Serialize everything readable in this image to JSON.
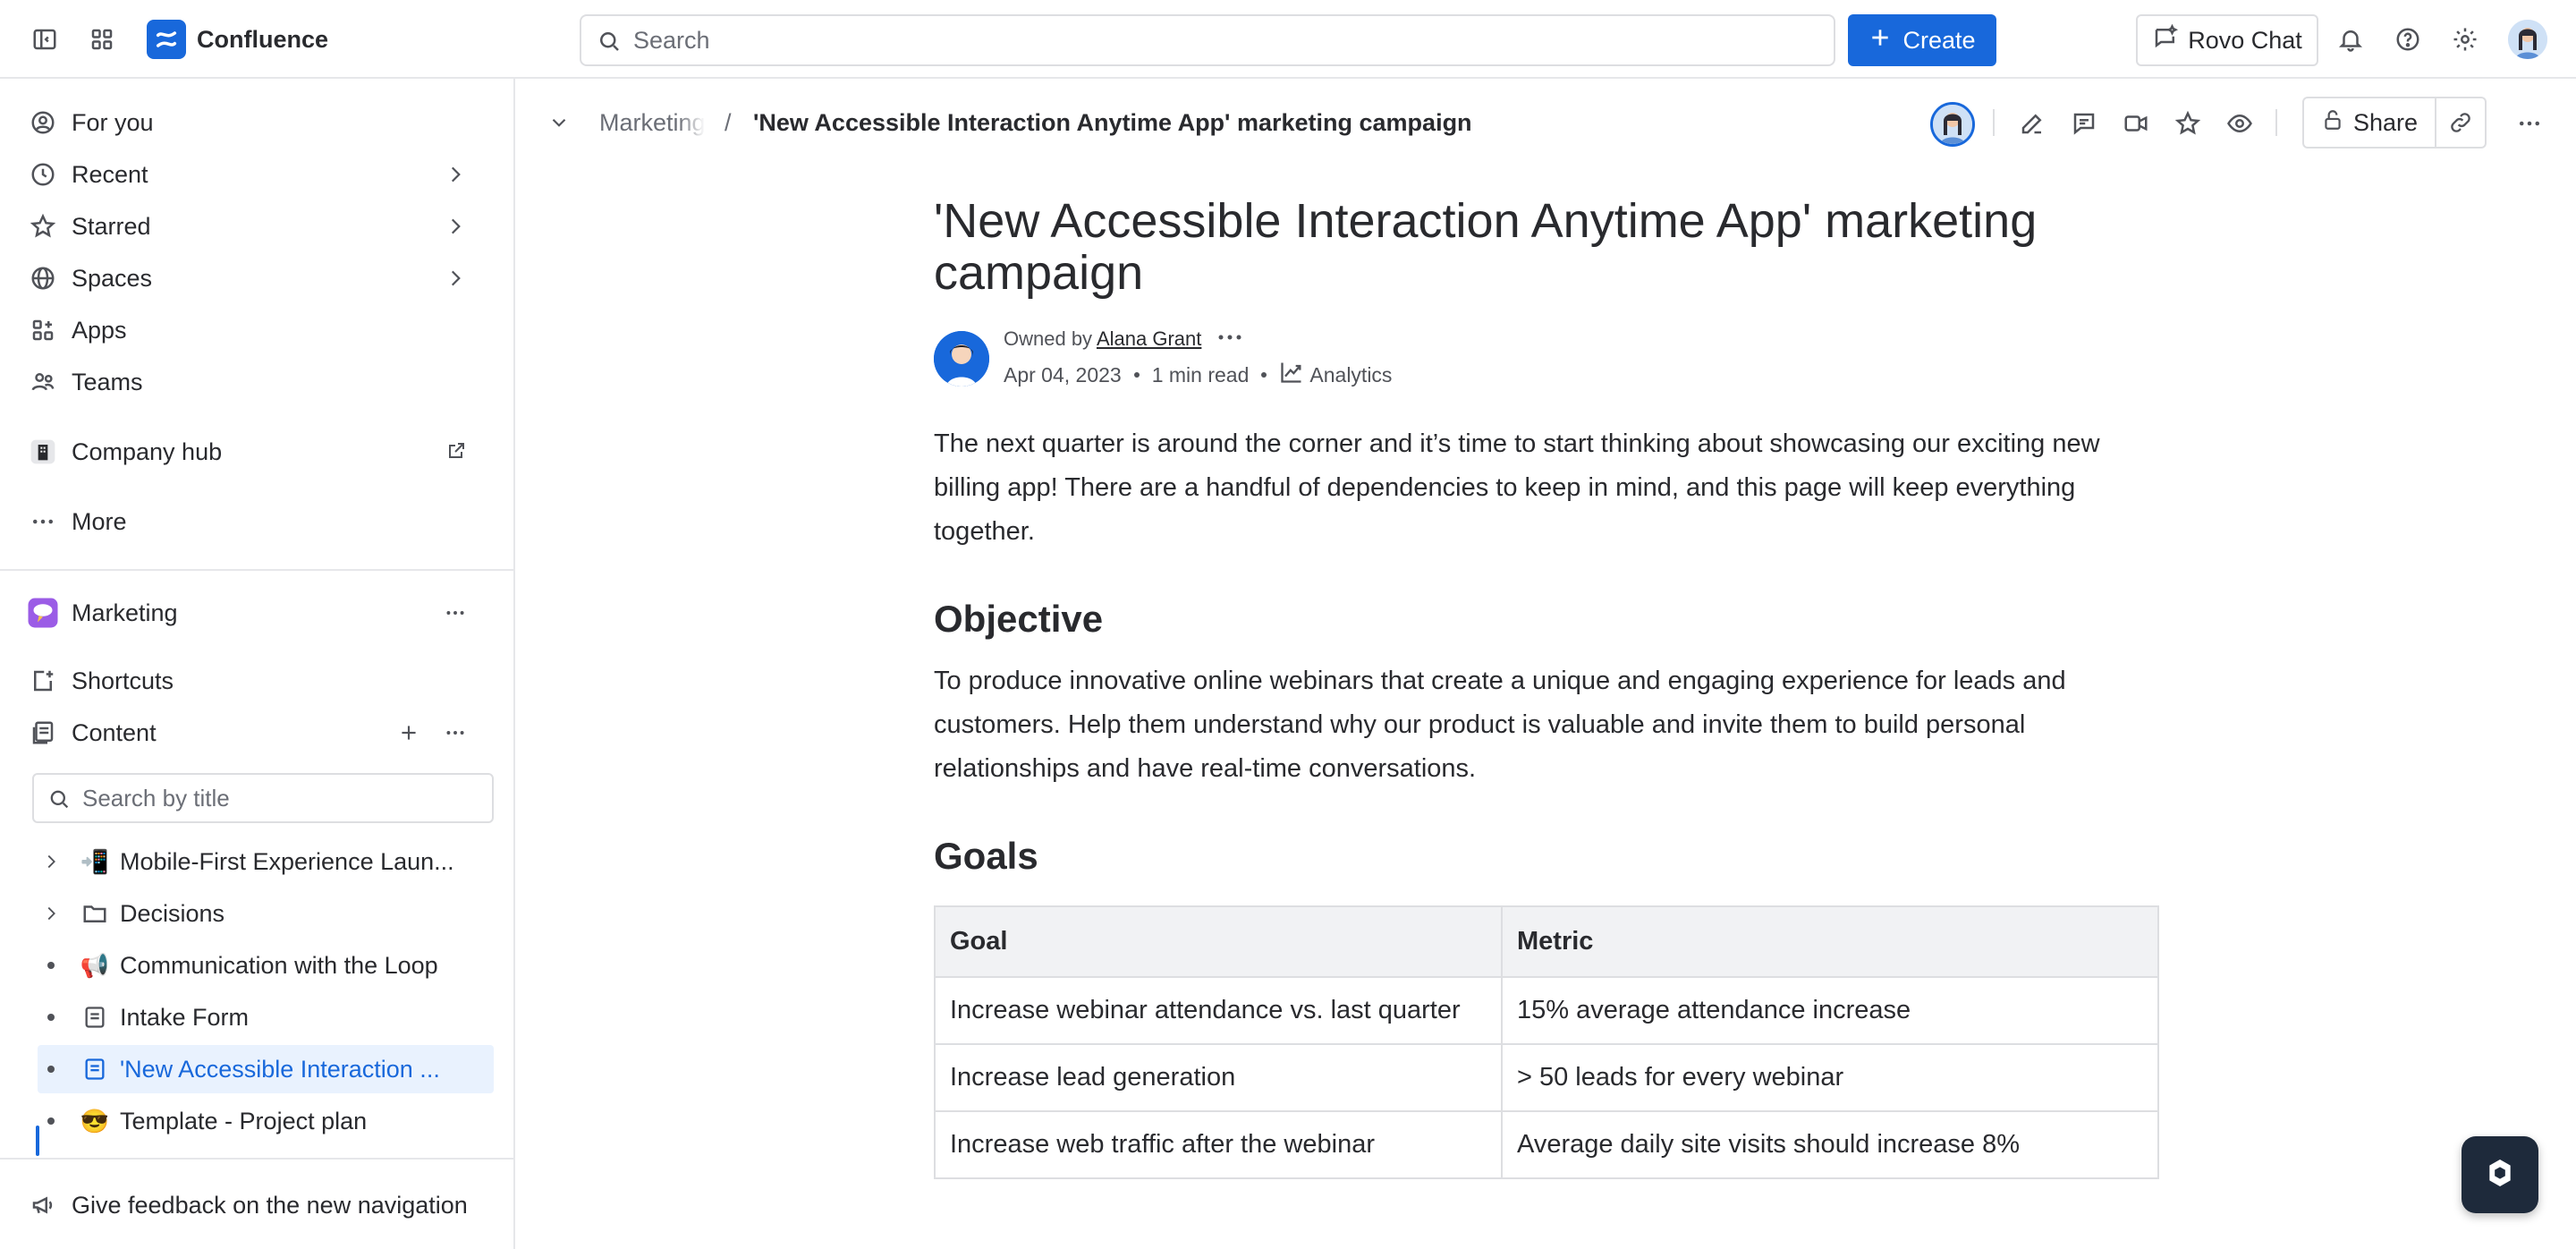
{
  "app": {
    "name": "Confluence",
    "search_placeholder": "Search",
    "create_label": "Create",
    "rovo_label": "Rovo Chat"
  },
  "sidebar": {
    "nav": [
      {
        "label": "For you",
        "icon": "user-circle-icon"
      },
      {
        "label": "Recent",
        "icon": "clock-icon"
      },
      {
        "label": "Starred",
        "icon": "star-icon"
      },
      {
        "label": "Spaces",
        "icon": "globe-icon"
      },
      {
        "label": "Apps",
        "icon": "apps-icon"
      },
      {
        "label": "Teams",
        "icon": "teams-icon"
      }
    ],
    "company_hub": "Company hub",
    "more": "More",
    "space_name": "Marketing",
    "shortcuts": "Shortcuts",
    "content": "Content",
    "search_placeholder": "Search by title",
    "tree": [
      {
        "label": "Mobile-First Experience Laun...",
        "emoji": "📲"
      },
      {
        "label": "Decisions",
        "emoji": "folder"
      },
      {
        "label": "Communication with the Loop",
        "emoji": "📢"
      },
      {
        "label": "Intake Form",
        "emoji": "page"
      },
      {
        "label": "'New Accessible Interaction ...",
        "emoji": "page"
      },
      {
        "label": "Template - Project plan",
        "emoji": "😎"
      }
    ],
    "feedback": "Give feedback on the new navigation"
  },
  "breadcrumb": {
    "parent": "Marketing",
    "separator": "/",
    "current": "'New Accessible Interaction Anytime App' marketing campaign"
  },
  "toolbar": {
    "share_label": "Share"
  },
  "page": {
    "title": "'New Accessible Interaction Anytime App' marketing campaign",
    "owned_by_prefix": "Owned by",
    "owner": "Alana Grant",
    "date": "Apr 04, 2023",
    "read_time": "1 min read",
    "analytics": "Analytics",
    "intro": "The next quarter is around the corner and it’s time to start thinking about showcasing our exciting new billing app!  There are a handful of dependencies to keep in mind, and this page will keep everything together.",
    "objective_heading": "Objective",
    "objective_text": "To produce innovative online webinars that create a unique and engaging experience for leads and customers. Help them understand why our product is valuable and invite them to build personal relationships and have real-time conversations.",
    "goals_heading": "Goals",
    "table": {
      "headers": [
        "Goal",
        "Metric"
      ],
      "rows": [
        [
          "Increase webinar attendance vs. last quarter",
          "15% average attendance increase"
        ],
        [
          "Increase lead generation",
          "> 50 leads for every webinar"
        ],
        [
          "Increase web traffic after the webinar",
          "Average daily site visits should increase 8%"
        ]
      ]
    }
  },
  "colors": {
    "brand": "#1868DB",
    "text": "#292A2E",
    "subtle": "#6B6E76",
    "border": "#DDDEE1",
    "active_bg": "#E9F2FE"
  }
}
